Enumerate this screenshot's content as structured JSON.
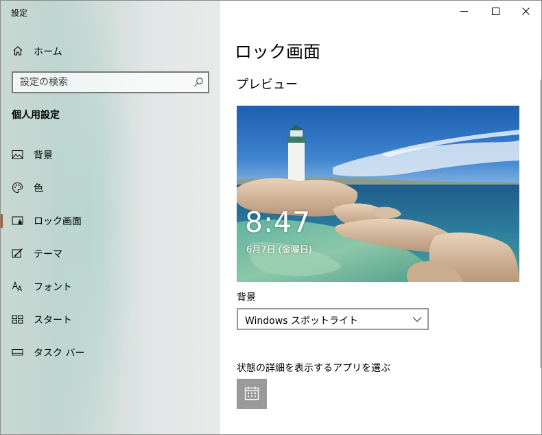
{
  "window": {
    "title": "設定",
    "controls": [
      "minimize",
      "maximize",
      "close"
    ]
  },
  "sidebar": {
    "home_label": "ホーム",
    "search_placeholder": "設定の検索",
    "section_title": "個人用設定",
    "items": [
      {
        "label": "背景",
        "icon": "picture-icon",
        "active": false
      },
      {
        "label": "色",
        "icon": "palette-icon",
        "active": false
      },
      {
        "label": "ロック画面",
        "icon": "lock-screen-icon",
        "active": true
      },
      {
        "label": "テーマ",
        "icon": "theme-icon",
        "active": false
      },
      {
        "label": "フォント",
        "icon": "font-icon",
        "active": false
      },
      {
        "label": "スタート",
        "icon": "start-icon",
        "active": false
      },
      {
        "label": "タスク バー",
        "icon": "taskbar-icon",
        "active": false
      }
    ],
    "active_color": "#b35a1f"
  },
  "main": {
    "page_title": "ロック画面",
    "preview_heading": "プレビュー",
    "preview_time": "8:47",
    "preview_date": "6月7日 (金曜日)",
    "background_label": "背景",
    "background_value": "Windows スポットライト",
    "status_label": "状態の詳細を表示するアプリを選ぶ",
    "status_app_icon": "calendar-icon"
  }
}
